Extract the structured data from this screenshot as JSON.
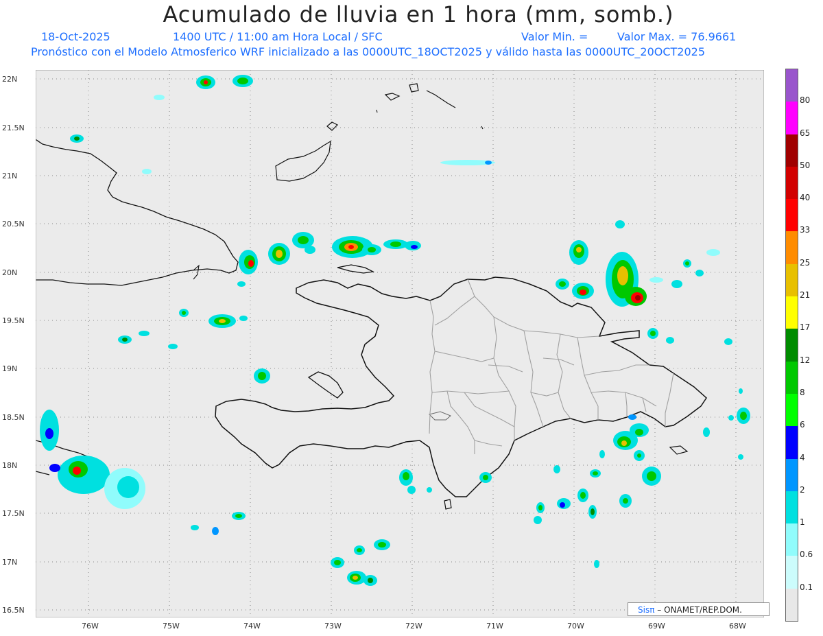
{
  "title": "Acumulado de lluvia en 1 hora (mm, somb.)",
  "info": {
    "date": "18-Oct-2025",
    "time": "1400 UTC / 11:00 am Hora Local / SFC",
    "vmin": "Valor Min. =",
    "vmax": "Valor Max. = 76.9661"
  },
  "subtitle": "Pronóstico con el Modelo Atmosferico WRF inicializado a las 0000UTC_18OCT2025 y válido hasta las  0000UTC_20OCT2025",
  "axes": {
    "y_labels": [
      "22N",
      "21.5N",
      "21N",
      "20.5N",
      "20N",
      "19.5N",
      "19N",
      "18.5N",
      "18N",
      "17.5N",
      "17N",
      "16.5N"
    ],
    "x_labels": [
      "76W",
      "75W",
      "74W",
      "73W",
      "72W",
      "71W",
      "70W",
      "69W",
      "68W"
    ],
    "lon_range": [
      -76.6,
      -67.6
    ],
    "lat_range": [
      16.45,
      22.1
    ]
  },
  "colorbar": {
    "levels": [
      "0.1",
      "0.6",
      "1",
      "2",
      "4",
      "6",
      "8",
      "12",
      "17",
      "21",
      "25",
      "33",
      "40",
      "50",
      "65",
      "80"
    ],
    "colors": [
      "#e8e8e8",
      "#ccfcfc",
      "#90fcfc",
      "#00e0e0",
      "#0096ff",
      "#0000ff",
      "#00ff00",
      "#00c800",
      "#008c00",
      "#ffff00",
      "#e8c000",
      "#ff8c00",
      "#ff0000",
      "#d20000",
      "#a00000",
      "#ff00ff",
      "#9955cc"
    ]
  },
  "credit": {
    "sis": "Sisπ",
    "org": " – ONAMET/REP.DOM."
  },
  "colors": {
    "ocean": "#ebebeb",
    "coast": "#111111",
    "province_borders": "#a0a0a0",
    "label_blue": "#1e6fff"
  }
}
